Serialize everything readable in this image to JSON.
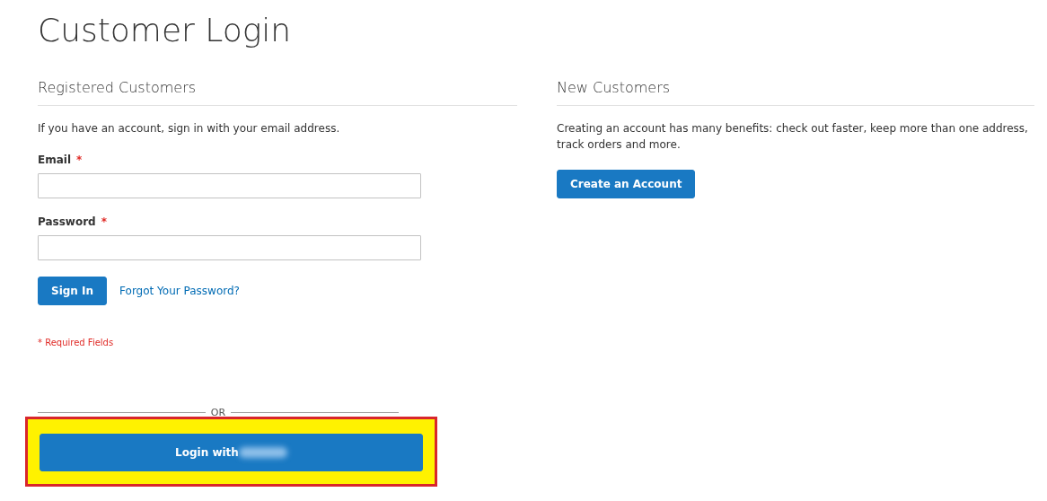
{
  "page_title": "Customer Login",
  "registered": {
    "heading": "Registered Customers",
    "intro": "If you have an account, sign in with your email address.",
    "fields": [
      {
        "label": "Email",
        "required_mark": "*"
      },
      {
        "label": "Password",
        "required_mark": "*"
      }
    ],
    "sign_in_button": "Sign In",
    "forgot_link": "Forgot Your Password?",
    "required_note": "* Required Fields"
  },
  "separator": "OR",
  "social_login": {
    "label": "Login with",
    "highlighted": true
  },
  "new_customers": {
    "heading": "New Customers",
    "intro": "Creating an account has many benefits: check out faster, keep more than one address, track orders and more.",
    "button": "Create an Account"
  }
}
